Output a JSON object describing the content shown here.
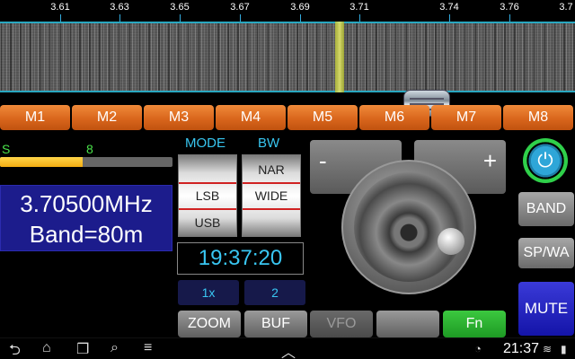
{
  "scale": {
    "ticks": [
      "3.61",
      "3.63",
      "3.65",
      "3.67",
      "3.69",
      "3.71",
      "3.74",
      "3.76",
      "3.7"
    ]
  },
  "memories": [
    "M1",
    "M2",
    "M3",
    "M4",
    "M5",
    "M6",
    "M7",
    "M8"
  ],
  "signal": {
    "label": "S",
    "value": "8",
    "level_fraction": 0.48
  },
  "frequency": {
    "freq_text": "3.70500MHz",
    "band_text": "Band=80m"
  },
  "mode": {
    "header": "MODE",
    "items": [
      "",
      "LSB",
      "USB"
    ],
    "selected": "LSB"
  },
  "bw": {
    "header": "BW",
    "items": [
      "NAR",
      "WIDE",
      ""
    ],
    "selected": "WIDE"
  },
  "clock": "19:37:20",
  "zoom_factor": "1x",
  "buffer_count": "2",
  "bottom_buttons": {
    "zoom": "ZOOM",
    "buf": "BUF",
    "vfo": "VFO",
    "blank": "",
    "fn": "Fn"
  },
  "step": {
    "minus": "-",
    "plus": "+"
  },
  "side": {
    "band": "BAND",
    "spwa": "SP/WA",
    "mute": "MUTE"
  },
  "statusbar": {
    "time": "21:37"
  },
  "colors": {
    "memory_button": "#e06a1f",
    "frequency_bg": "#1c1c8c",
    "accent_cyan": "#39c6f2",
    "signal_green": "#4be34b",
    "fn_button": "#26b02e",
    "mute_button": "#1e1ec0"
  }
}
